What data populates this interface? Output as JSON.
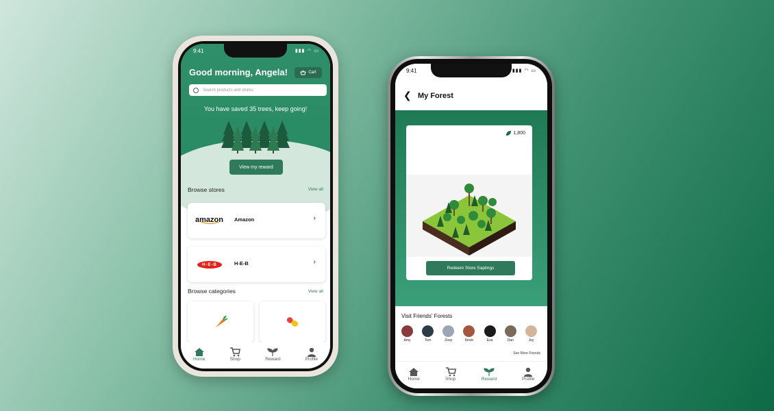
{
  "home_screen": {
    "status_time": "9:41",
    "greeting": "Good morning, Angela!",
    "cart_label": "Cart",
    "search_placeholder": "Search products and stores.",
    "saved_message": "You have saved 35 trees, keep going!",
    "view_reward_label": "View my reward",
    "browse_stores_title": "Browse stores",
    "browse_stores_view_all": "View all",
    "stores": [
      {
        "name": "Amazon",
        "logo_text": "amazon"
      },
      {
        "name": "H-E-B",
        "logo_text": "H-E-B"
      }
    ],
    "browse_categories_title": "Browse categories",
    "browse_categories_view_all": "View all",
    "categories": [
      {
        "icon": "carrot-icon"
      },
      {
        "icon": "pill-icon"
      }
    ],
    "nav": [
      {
        "label": "Home",
        "icon": "home-icon",
        "active": true
      },
      {
        "label": "Shop",
        "icon": "cart-icon",
        "active": false
      },
      {
        "label": "Reward",
        "icon": "sprout-icon",
        "active": false
      },
      {
        "label": "Profile",
        "icon": "person-icon",
        "active": false
      }
    ]
  },
  "forest_screen": {
    "status_time": "9:41",
    "title": "My Forest",
    "points": "1,800",
    "redeem_label": "Redeem Store Saplings",
    "friends_title": "Visit Friends' Forests",
    "friends": [
      {
        "name": "Amy",
        "color": "#8b3a3a"
      },
      {
        "name": "Tom",
        "color": "#2d3a48"
      },
      {
        "name": "Zoey",
        "color": "#9aa6b5"
      },
      {
        "name": "Kevin",
        "color": "#a4563f"
      },
      {
        "name": "Eva",
        "color": "#1a1a1a"
      },
      {
        "name": "Dan",
        "color": "#7b6a5a"
      },
      {
        "name": "Joy",
        "color": "#d4b49a"
      }
    ],
    "see_more_friends": "See More Friends",
    "nav": [
      {
        "label": "Home",
        "icon": "home-icon",
        "active": false
      },
      {
        "label": "Shop",
        "icon": "cart-icon",
        "active": false
      },
      {
        "label": "Reward",
        "icon": "sprout-icon",
        "active": true
      },
      {
        "label": "Profile",
        "icon": "person-icon",
        "active": false
      }
    ]
  },
  "colors": {
    "accent": "#2f7a5b",
    "header_green": "#2f8f6a"
  }
}
